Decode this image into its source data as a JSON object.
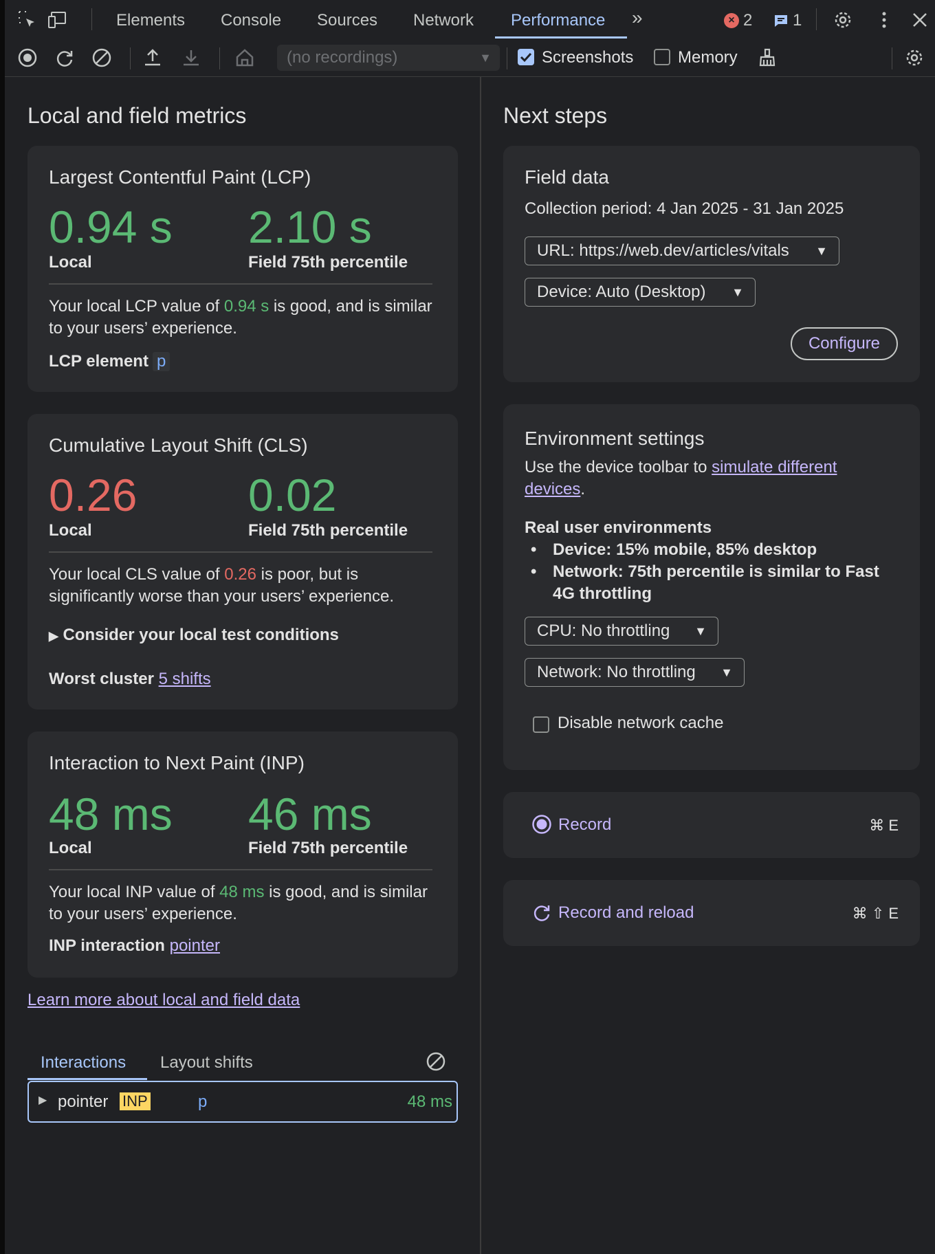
{
  "tabs": {
    "items": [
      "Elements",
      "Console",
      "Sources",
      "Network",
      "Performance"
    ],
    "active": "Performance",
    "error_count": "2",
    "message_count": "1"
  },
  "toolbar": {
    "recording_select": "(no recordings)",
    "screenshots_label": "Screenshots",
    "screenshots_checked": true,
    "memory_label": "Memory",
    "memory_checked": false
  },
  "left": {
    "section_title": "Local and field metrics",
    "lcp": {
      "title": "Largest Contentful Paint (LCP)",
      "local_value": "0.94 s",
      "local_label": "Local",
      "field_value": "2.10 s",
      "field_label": "Field 75th percentile",
      "desc_pre": "Your local LCP value of ",
      "desc_value": "0.94 s",
      "desc_post": " is good, and is similar to your users’ experience.",
      "element_label": "LCP element",
      "element_value": "p"
    },
    "cls": {
      "title": "Cumulative Layout Shift (CLS)",
      "local_value": "0.26",
      "local_label": "Local",
      "field_value": "0.02",
      "field_label": "Field 75th percentile",
      "desc_pre": "Your local CLS value of ",
      "desc_value": "0.26",
      "desc_post": " is poor, but is significantly worse than your users’ experience.",
      "consider": "Consider your local test conditions",
      "cluster_label": "Worst cluster",
      "cluster_link": "5 shifts"
    },
    "inp": {
      "title": "Interaction to Next Paint (INP)",
      "local_value": "48 ms",
      "local_label": "Local",
      "field_value": "46 ms",
      "field_label": "Field 75th percentile",
      "desc_pre": "Your local INP value of ",
      "desc_value": "48 ms",
      "desc_post": " is good, and is similar to your users’ experience.",
      "interaction_label": "INP interaction",
      "interaction_link": "pointer"
    },
    "learn_more": "Learn more about local and field data",
    "bottom_tabs": [
      "Interactions",
      "Layout shifts"
    ],
    "row": {
      "name": "pointer",
      "badge": "INP",
      "element": "p",
      "value": "48 ms"
    }
  },
  "right": {
    "section_title": "Next steps",
    "field": {
      "title": "Field data",
      "period": "Collection period: 4 Jan 2025 - 31 Jan 2025",
      "url_select": "URL: https://web.dev/articles/vitals",
      "device_select": "Device: Auto (Desktop)",
      "configure": "Configure"
    },
    "env": {
      "title": "Environment settings",
      "desc_pre": "Use the device toolbar to ",
      "desc_link": "simulate different devices",
      "desc_post": ".",
      "real_title": "Real user environments",
      "bullet1": "Device: 15% mobile, 85% desktop",
      "bullet2": "Network: 75th percentile is similar to Fast 4G throttling",
      "cpu_select": "CPU: No throttling",
      "network_select": "Network: No throttling",
      "disable_cache": "Disable network cache"
    },
    "record": {
      "label": "Record",
      "shortcut": "⌘ E"
    },
    "record_reload": {
      "label": "Record and reload",
      "shortcut": "⌘ ⇧ E"
    }
  }
}
